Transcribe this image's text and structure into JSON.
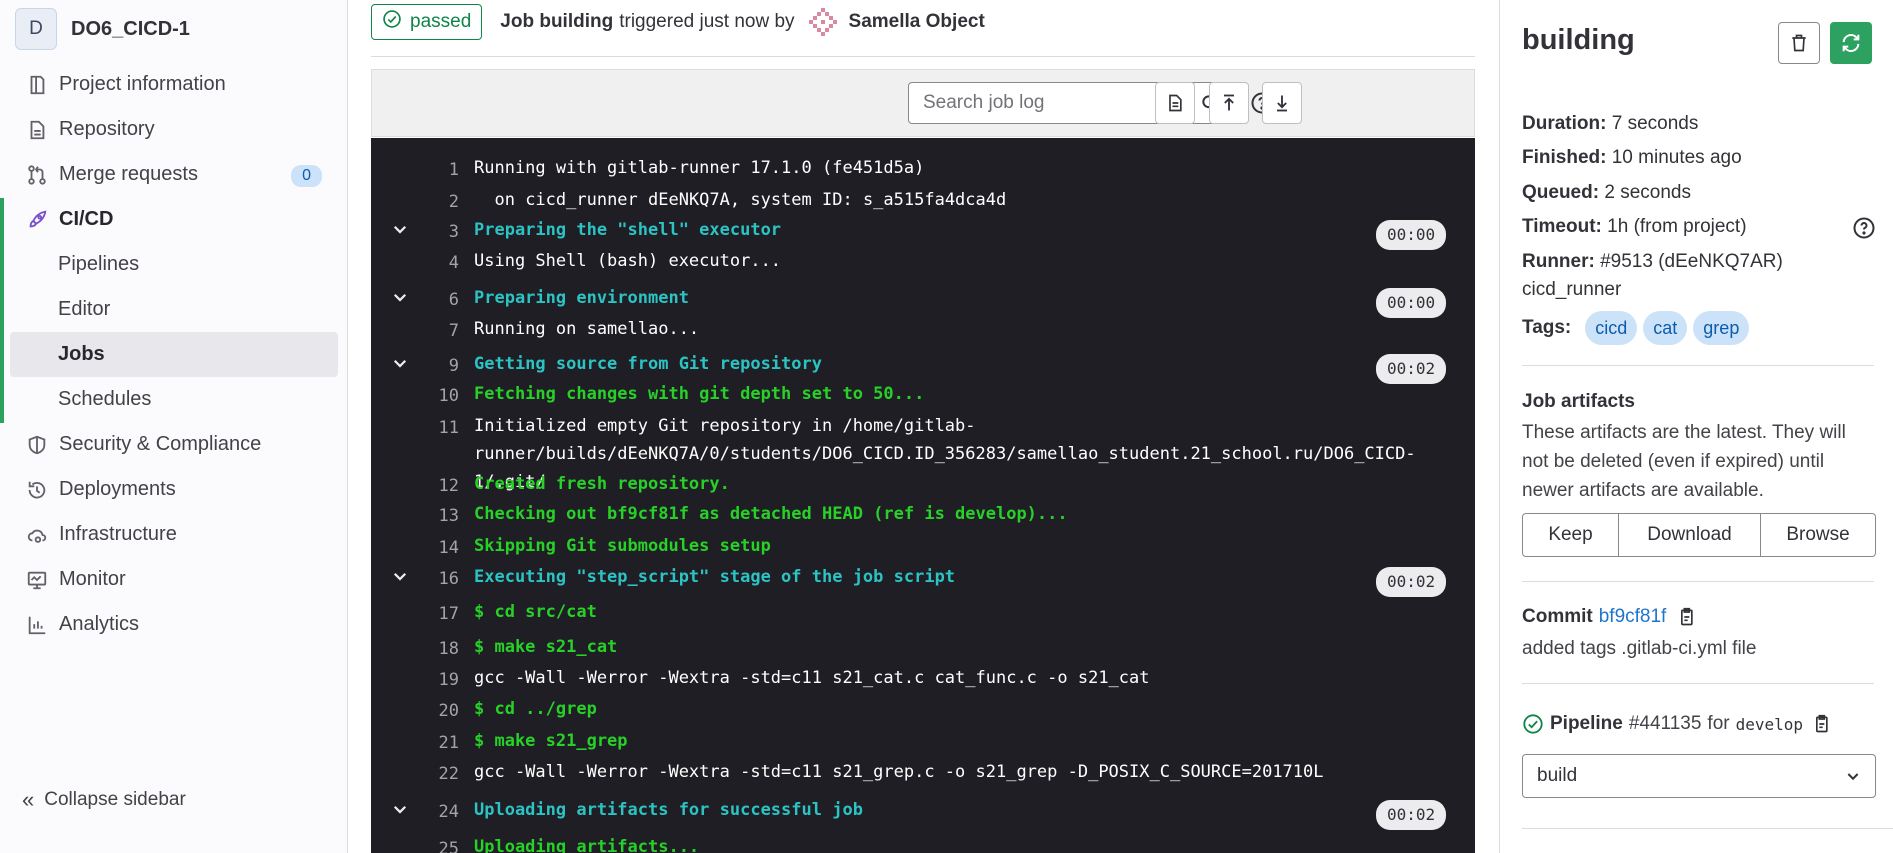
{
  "project": {
    "avatar_letter": "D",
    "name": "DO6_CICD-1"
  },
  "nav": {
    "project_information": "Project information",
    "repository": "Repository",
    "merge_requests": "Merge requests",
    "merge_requests_count": "0",
    "cicd": "CI/CD",
    "pipelines": "Pipelines",
    "editor": "Editor",
    "jobs": "Jobs",
    "schedules": "Schedules",
    "security": "Security & Compliance",
    "deployments": "Deployments",
    "infrastructure": "Infrastructure",
    "monitor": "Monitor",
    "analytics": "Analytics",
    "collapse": "Collapse sidebar"
  },
  "header": {
    "status": "passed",
    "job_name": "Job building",
    "triggered_text": "triggered just now by",
    "user": "Samella Object"
  },
  "toolbar": {
    "search_placeholder": "Search job log",
    "search_value": ""
  },
  "log": [
    {
      "n": "1",
      "text": "Running with gitlab-runner 17.1.0 (fe451d5a)",
      "color": "white"
    },
    {
      "n": "2",
      "text": "  on cicd_runner dEeNKQ7A, system ID: s_a515fa4dca4d",
      "color": "white"
    },
    {
      "n": "3",
      "text": "Preparing the \"shell\" executor",
      "color": "cyan",
      "time": "00:00"
    },
    {
      "n": "4",
      "text": "Using Shell (bash) executor...",
      "color": "white"
    },
    {
      "n": "6",
      "text": "Preparing environment",
      "color": "cyan",
      "time": "00:00"
    },
    {
      "n": "7",
      "text": "Running on samellao...",
      "color": "white"
    },
    {
      "n": "9",
      "text": "Getting source from Git repository",
      "color": "cyan",
      "time": "00:02"
    },
    {
      "n": "10",
      "text": "Fetching changes with git depth set to 50...",
      "color": "green"
    },
    {
      "n": "11",
      "text": "Initialized empty Git repository in /home/gitlab-runner/builds/dEeNKQ7A/0/students/DO6_CICD.ID_356283/samellao_student.21_school.ru/DO6_CICD-1/.git/",
      "color": "white"
    },
    {
      "n": "12",
      "text": "Created fresh repository.",
      "color": "green"
    },
    {
      "n": "13",
      "text": "Checking out bf9cf81f as detached HEAD (ref is develop)...",
      "color": "green"
    },
    {
      "n": "14",
      "text": "Skipping Git submodules setup",
      "color": "green"
    },
    {
      "n": "16",
      "text": "Executing \"step_script\" stage of the job script",
      "color": "cyan",
      "time": "00:02"
    },
    {
      "n": "17",
      "text": "$ cd src/cat",
      "color": "green"
    },
    {
      "n": "18",
      "text": "$ make s21_cat",
      "color": "green"
    },
    {
      "n": "19",
      "text": "gcc -Wall -Werror -Wextra -std=c11 s21_cat.c cat_func.c -o s21_cat",
      "color": "white"
    },
    {
      "n": "20",
      "text": "$ cd ../grep",
      "color": "green"
    },
    {
      "n": "21",
      "text": "$ make s21_grep",
      "color": "green"
    },
    {
      "n": "22",
      "text": "gcc -Wall -Werror -Wextra -std=c11 s21_grep.c -o s21_grep -D_POSIX_C_SOURCE=201710L",
      "color": "white"
    },
    {
      "n": "24",
      "text": "Uploading artifacts for successful job",
      "color": "cyan",
      "time": "00:02"
    },
    {
      "n": "25",
      "text": "Uploading artifacts...",
      "color": "green"
    }
  ],
  "details": {
    "title": "building",
    "duration_label": "Duration:",
    "duration": "7 seconds",
    "finished_label": "Finished:",
    "finished": "10 minutes ago",
    "queued_label": "Queued:",
    "queued": "2 seconds",
    "timeout_label": "Timeout:",
    "timeout": "1h (from project)",
    "runner_label": "Runner:",
    "runner": "#9513 (dEeNKQ7AR)",
    "runner_name": "cicd_runner",
    "tags_label": "Tags:",
    "tags": [
      "cicd",
      "cat",
      "grep"
    ]
  },
  "artifacts": {
    "title": "Job artifacts",
    "description": "These artifacts are the latest. They will not be deleted (even if expired) until newer artifacts are available.",
    "keep": "Keep",
    "download": "Download",
    "browse": "Browse"
  },
  "commit": {
    "label": "Commit",
    "sha": "bf9cf81f",
    "message": "added tags .gitlab-ci.yml file"
  },
  "pipeline": {
    "label": "Pipeline",
    "id": "#441135",
    "for_text": "for",
    "ref": "develop",
    "stage_selected": "build"
  },
  "colors": {
    "green": "#2da160",
    "log_bg": "#1f1e24",
    "link": "#1f75cb"
  }
}
